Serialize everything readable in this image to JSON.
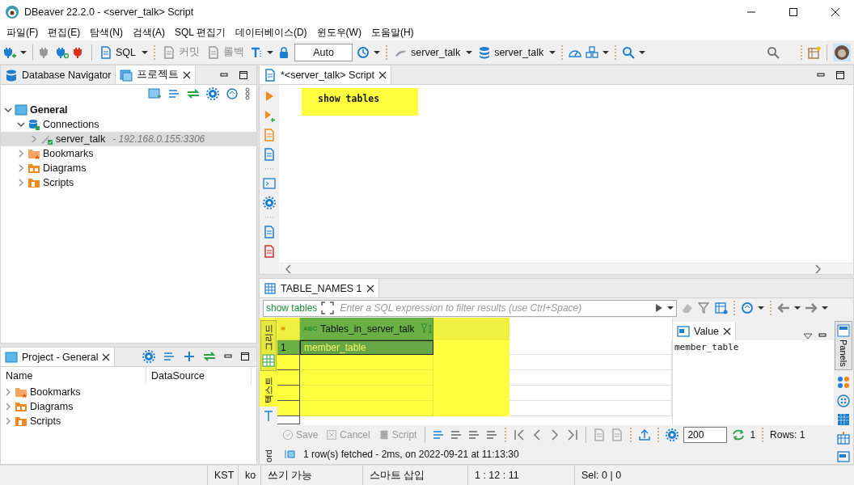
{
  "window": {
    "title": "DBeaver 22.2.0 - <server_talk> Script"
  },
  "menu": [
    "파일(F)",
    "편집(E)",
    "탐색(N)",
    "검색(A)",
    "SQL 편집기",
    "데이터베이스(D)",
    "윈도우(W)",
    "도움말(H)"
  ],
  "toolbar": {
    "sql": "SQL",
    "commit": "커밋",
    "rollback": "롤백",
    "mode": "Auto",
    "datasource": "server_talk",
    "schema": "server_talk"
  },
  "navigator": {
    "tabs": [
      {
        "label": "Database Navigator",
        "selected": false
      },
      {
        "label": "프로젝트",
        "selected": true
      }
    ],
    "tree": [
      {
        "label": "General",
        "kind": "project",
        "expanded": true,
        "selected": false,
        "children": [
          {
            "label": "Connections",
            "kind": "connections",
            "expanded": true,
            "selected": false,
            "children": [
              {
                "label": "server_talk",
                "detail": "- 192.168.0.155:3306",
                "kind": "connection",
                "expanded": false,
                "selected": true
              }
            ]
          },
          {
            "label": "Bookmarks",
            "kind": "bookmarks",
            "expanded": false,
            "selected": false
          },
          {
            "label": "Diagrams",
            "kind": "diagrams",
            "expanded": false,
            "selected": false
          },
          {
            "label": "Scripts",
            "kind": "scripts",
            "expanded": false,
            "selected": false
          }
        ]
      }
    ]
  },
  "project_panel": {
    "title": "Project - General",
    "columns": [
      "Name",
      "DataSource"
    ],
    "items": [
      {
        "label": "Bookmarks",
        "kind": "bookmarks"
      },
      {
        "label": "Diagrams",
        "kind": "diagrams"
      },
      {
        "label": "Scripts",
        "kind": "scripts"
      }
    ]
  },
  "editor": {
    "tab": "*<server_talk> Script",
    "lines": [
      "show tables"
    ]
  },
  "results": {
    "tab": "TABLE_NAMES 1",
    "query": "show tables",
    "filter_placeholder": "Enter a SQL expression to filter results (use Ctrl+Space)",
    "side_tabs": [
      {
        "label": "그리드",
        "selected": true
      },
      {
        "label": "텍스트",
        "selected": false
      }
    ],
    "record_tab": "ord",
    "type_badge": "ABC",
    "columns": [
      "Tables_in_server_talk"
    ],
    "rows": [
      {
        "num": "1",
        "cells": [
          "member_table"
        ],
        "selected": true
      }
    ],
    "value_panel": {
      "title": "Value",
      "content": "member_table"
    },
    "panels_tab": "Panels",
    "actions": [
      "Save",
      "Cancel",
      "Script"
    ],
    "fetch_size": "200",
    "refresh_count": "1",
    "rows_count": "Rows: 1",
    "message": "1 row(s) fetched - 2ms, on 2022-09-21 at 11:13:30"
  },
  "status_bar": [
    "KST",
    "ko",
    "쓰기 가능",
    "스마트 삽입",
    "1 : 12 : 11",
    "Sel: 0 | 0"
  ]
}
